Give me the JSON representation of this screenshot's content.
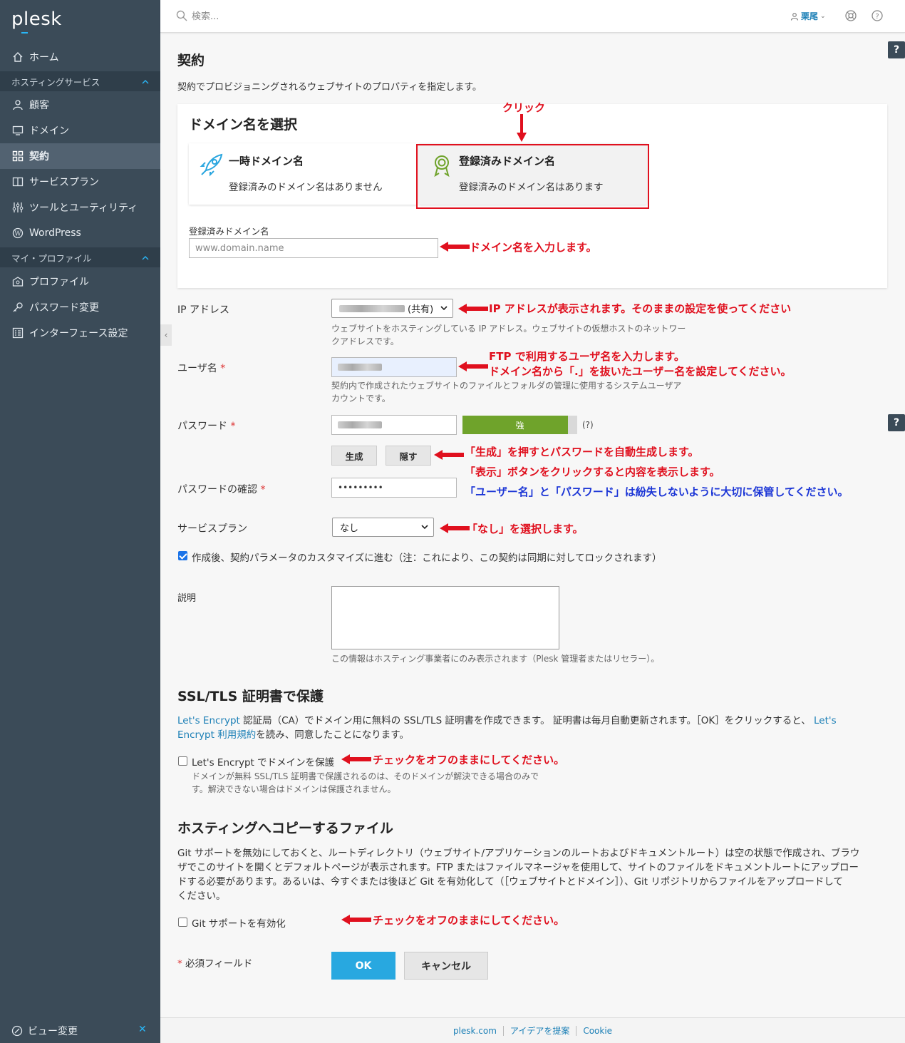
{
  "sidebar": {
    "logo": "plesk",
    "home": "ホーム",
    "section_hosting": "ホスティングサービス",
    "items": [
      "顧客",
      "ドメイン",
      "契約",
      "サービスプラン",
      "ツールとユーティリティ",
      "WordPress"
    ],
    "section_profile": "マイ・プロファイル",
    "profile_items": [
      "プロファイル",
      "パスワード変更",
      "インターフェース設定"
    ],
    "footer": "ビュー変更"
  },
  "header": {
    "search_placeholder": "検索...",
    "user": "栗尾"
  },
  "page": {
    "title": "契約",
    "description": "契約でプロビジョニングされるウェブサイトのプロパティを指定します。"
  },
  "domain_card": {
    "title": "ドメイン名を選択",
    "temp": {
      "title": "一時ドメイン名",
      "subtitle": "登録済みのドメイン名はありません"
    },
    "registered": {
      "title": "登録済みドメイン名",
      "subtitle": "登録済みのドメイン名はあります"
    },
    "field_label": "登録済みドメイン名",
    "field_placeholder": "www.domain.name"
  },
  "form": {
    "ip_label": "IP アドレス",
    "ip_value_suffix": "(共有)",
    "ip_hint_1": "ウェブサイトをホスティングしている IP アドレス。ウェブサイトの仮想ホストのネットワー",
    "ip_hint_2": "クアドレスです。",
    "user_label": "ユーザ名",
    "user_hint_1": "契約内で作成されたウェブサイトのファイルとフォルダの管理に使用するシステムユーザア",
    "user_hint_2": "カウントです。",
    "password_label": "パスワード",
    "strength": "強",
    "help_mark": "(?)",
    "generate": "生成",
    "hide": "隠す",
    "confirm_label": "パスワードの確認",
    "confirm_value": "•••••••••",
    "plan_label": "サービスプラン",
    "plan_value": "なし",
    "customize_label": "作成後、契約パラメータのカスタマイズに進む（注：これにより、この契約は同期に対してロックされます）",
    "desc_label": "説明",
    "desc_hint": "この情報はホスティング事業者にのみ表示されます（Plesk 管理者またはリセラー）。",
    "required_mark": "*"
  },
  "ssl": {
    "title": "SSL/TLS 証明書で保護",
    "link1": "Let's Encrypt",
    "text1": " 認証局（CA）でドメイン用に無料の SSL/TLS 証明書を作成できます。 証明書は毎月自動更新されます。［OK］をクリックすると、",
    "link2": "Let's Encrypt 利用規約",
    "text2": "を読み、同意したことになります。",
    "checkbox_label": "Let's Encrypt でドメインを保護",
    "hint_1": "ドメインが無料 SSL/TLS 証明書で保護されるのは、そのドメインが解決できる場合のみで",
    "hint_2": "す。解決できない場合はドメインは保護されません。"
  },
  "files": {
    "title": "ホスティングへコピーするファイル",
    "para_1": "Git サポートを無効にしておくと、ルートディレクトリ（ウェブサイト/アプリケーションのルートおよびドキュメントルート）は空の状態で作成され、ブラウ",
    "para_2": "ザでこのサイトを開くとデフォルトページが表示されます。FTP またはファイルマネージャを使用して、サイトのファイルをドキュメントルートにアップロー",
    "para_3": "ドする必要があります。あるいは、今すぐまたは後ほど Git を有効化して（［ウェブサイトとドメイン］）、Git リポジトリからファイルをアップロードして",
    "para_4": "ください。",
    "checkbox_label": "Git サポートを有効化"
  },
  "actions": {
    "required_note": "必須フィールド",
    "ok": "OK",
    "cancel": "キャンセル"
  },
  "annotations": {
    "click": "クリック",
    "domain_input": "ドメイン名を入力します。",
    "ip": "IP アドレスが表示されます。そのままの設定を使ってください",
    "user_1": "FTP で利用するユーザ名を入力します。",
    "user_2": "ドメイン名から「.」を抜いたユーザー名を設定してください。",
    "pw_1": "「生成」を押すとパスワードを自動生成します。",
    "pw_2": "「表示」ボタンをクリックすると内容を表示します。",
    "pw_3": "「ユーザー名」と「パスワード」は紛失しないように大切に保管してください。",
    "plan": "「なし」を選択します。",
    "ssl": "チェックをオフのままにしてください。",
    "git": "チェックをオフのままにしてください。"
  },
  "footer": {
    "links": [
      "plesk.com",
      "アイデアを提案",
      "Cookie"
    ]
  },
  "colors": {
    "sidebar": "#3b4b58",
    "accent": "#28a8e0",
    "annotation_red": "#e0101e",
    "annotation_blue": "#1b35d6",
    "strength_green": "#6fa32b"
  }
}
